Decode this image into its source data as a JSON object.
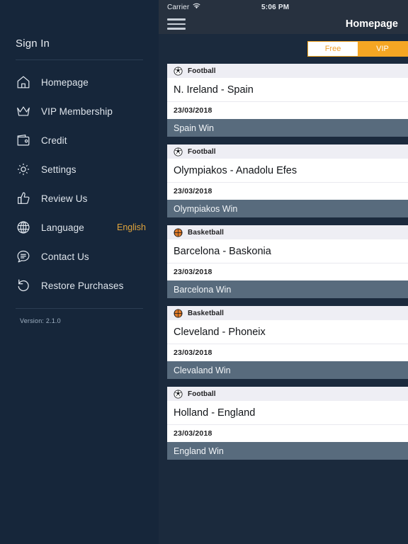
{
  "sidebar": {
    "sign_in_label": "Sign In",
    "items": [
      {
        "label": "Homepage",
        "icon": "home-icon",
        "value": ""
      },
      {
        "label": "VIP Membership",
        "icon": "crown-icon",
        "value": ""
      },
      {
        "label": "Credit",
        "icon": "wallet-icon",
        "value": ""
      },
      {
        "label": "Settings",
        "icon": "gear-icon",
        "value": ""
      },
      {
        "label": "Review Us",
        "icon": "thumbs-up-icon",
        "value": ""
      },
      {
        "label": "Language",
        "icon": "globe-icon",
        "value": "English"
      },
      {
        "label": "Contact Us",
        "icon": "chat-icon",
        "value": ""
      },
      {
        "label": "Restore Purchases",
        "icon": "restore-icon",
        "value": ""
      }
    ],
    "version": "Version: 2.1.0"
  },
  "statusbar": {
    "carrier": "Carrier",
    "wifi_icon": "wifi-icon",
    "time": "5:06 PM"
  },
  "navbar": {
    "menu_icon": "hamburger-menu-icon",
    "title": "Homepage"
  },
  "segmented_control": {
    "free_label": "Free",
    "vip_label": "VIP",
    "selected": "VIP"
  },
  "matches": [
    {
      "sport": "Football",
      "sport_icon": "soccer-ball-icon",
      "title": "N. Ireland - Spain",
      "date": "23/03/2018",
      "prediction": "Spain Win"
    },
    {
      "sport": "Football",
      "sport_icon": "soccer-ball-icon",
      "title": "Olympiakos - Anadolu Efes",
      "date": "23/03/2018",
      "prediction": "Olympiakos Win"
    },
    {
      "sport": "Basketball",
      "sport_icon": "basketball-icon",
      "title": "Barcelona - Baskonia",
      "date": "23/03/2018",
      "prediction": "Barcelona Win"
    },
    {
      "sport": "Basketball",
      "sport_icon": "basketball-icon",
      "title": "Cleveland - Phoneix",
      "date": "23/03/2018",
      "prediction": "Clevaland Win"
    },
    {
      "sport": "Football",
      "sport_icon": "soccer-ball-icon",
      "title": "Holland - England",
      "date": "23/03/2018",
      "prediction": "England Win"
    }
  ],
  "colors": {
    "sidebar_bg": "#16263a",
    "content_bg": "#1b2a3d",
    "statusbar_bg": "#27313f",
    "accent_orange": "#f5a623",
    "language_value": "#e0a43c",
    "prediction_bar": "#586b7d",
    "card_header_bg": "#eeeef4"
  }
}
